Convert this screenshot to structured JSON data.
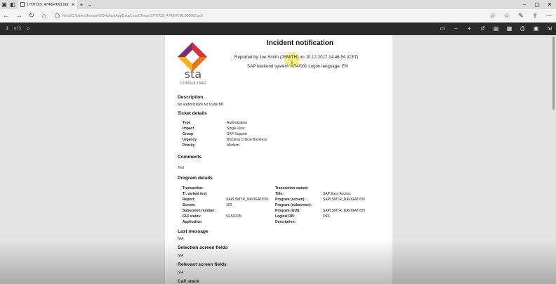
{
  "browser": {
    "tab_title": "17f7f725_4748HTML00(",
    "address": "file:///C:/Users/Tomas%20Hulics/AppData/Local/Temp/17f7f725_4748HTML000002.pdf"
  },
  "pdf_toolbar": {
    "page_number": "1",
    "page_count": "of 3"
  },
  "document": {
    "logo_text": "sta",
    "logo_sub": "CONSULTING",
    "title": "Incident notification",
    "reported": "Reported by Joe Smith (JSMITH) on 10.12.2017 14:46:54 (CET)",
    "backend": "SAP backend system: N74/001 Logon language: EN",
    "description_heading": "Description",
    "description_text": "No authorization for tcode BP",
    "ticket_heading": "Ticket details",
    "ticket": [
      {
        "label": "Type",
        "value": "Authorization"
      },
      {
        "label": "Impact",
        "value": "Single User"
      },
      {
        "label": "Group",
        "value": "SAP Support"
      },
      {
        "label": "Urgency",
        "value": "Blocking Critical Business"
      },
      {
        "label": "Priority",
        "value": "Medium"
      }
    ],
    "comments_heading": "Comments",
    "comments_text": "Test",
    "program_heading": "Program details",
    "program_left": [
      {
        "label": "Transaction:",
        "value": ""
      },
      {
        "label": "Tr. variant text:",
        "value": ""
      },
      {
        "label": "Report:",
        "value": "SAPLSMTR_NAVIGATION"
      },
      {
        "label": "Screen:",
        "value": "100"
      },
      {
        "label": "Subscreen number:",
        "value": ""
      },
      {
        "label": "GUI status:",
        "value": "SESSION"
      },
      {
        "label": "Application",
        "value": ""
      }
    ],
    "program_right": [
      {
        "label": "Transaction variant:",
        "value": ""
      },
      {
        "label": "Title:",
        "value": "SAP Easy Access"
      },
      {
        "label": "Program (screen):",
        "value": "SAPLSMTR_NAVIGATION"
      },
      {
        "label": "Program (subscreen):",
        "value": ""
      },
      {
        "label": "Program (GUI):",
        "value": "SAPLSMTR_NAVIGATION"
      },
      {
        "label": "Logical DB:",
        "value": "D$S"
      },
      {
        "label": "Description:",
        "value": ""
      }
    ],
    "last_message_heading": "Last message",
    "last_message_text": "N/A",
    "selection_heading": "Selection screen fields",
    "selection_text": "N/A",
    "relevant_heading": "Relevant screen fields",
    "relevant_text": "N/A",
    "callstack_heading": "Call stack"
  },
  "colors": {
    "logo_purple": "#7a2d6e",
    "logo_red": "#d4343a",
    "logo_yellow": "#f2b21b",
    "logo_orange": "#e8731e",
    "pdf_toolbar_bg": "#2b2b2b"
  }
}
